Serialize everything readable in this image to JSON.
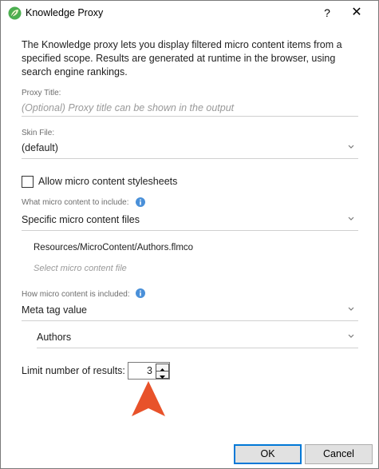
{
  "window": {
    "title": "Knowledge Proxy",
    "help_label": "?",
    "close_label": "✕"
  },
  "description": "The Knowledge proxy lets you display filtered micro content items from a specified scope. Results are generated at runtime in the browser, using search engine rankings.",
  "proxy_title": {
    "label": "Proxy Title:",
    "placeholder": "(Optional) Proxy title can be shown in the output",
    "value": ""
  },
  "skin_file": {
    "label": "Skin File:",
    "value": "(default)"
  },
  "allow_stylesheets": {
    "label": "Allow micro content stylesheets",
    "checked": false
  },
  "include_what": {
    "label": "What micro content to include:",
    "value": "Specific micro content files",
    "files": [
      "Resources/MicroContent/Authors.flmco"
    ],
    "add_placeholder": "Select micro content file"
  },
  "include_how": {
    "label": "How micro content is included:",
    "value": "Meta tag value",
    "sub_value": "Authors"
  },
  "limit": {
    "label": "Limit number of results:",
    "value": "3"
  },
  "buttons": {
    "ok": "OK",
    "cancel": "Cancel"
  },
  "colors": {
    "app_icon": "#4caf50",
    "info_icon": "#4a90d9",
    "arrow_marker": "#e8522a",
    "ok_border": "#0078d7"
  }
}
